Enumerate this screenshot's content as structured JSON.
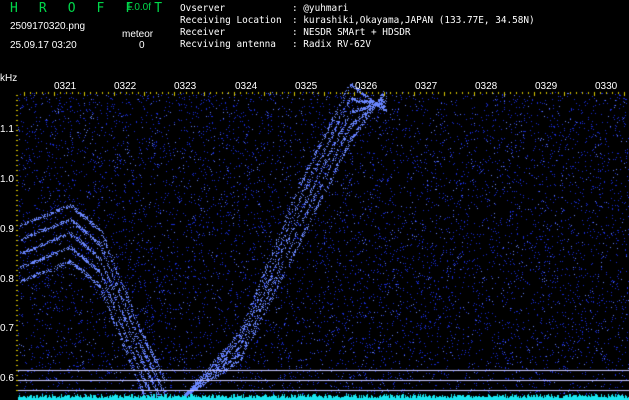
{
  "header": {
    "app_name": "H R O F F T",
    "version": "1.0.0f",
    "file_name": "2509170320.png",
    "timestamp": "25.09.17 03:20",
    "meteor_label": "meteor",
    "meteor_count": "0"
  },
  "station": [
    {
      "key": "Ovserver",
      "value": ": @yuhmari"
    },
    {
      "key": "Receiving Location",
      "value": ": kurashiki,Okayama,JAPAN (133.77E, 34.58N)"
    },
    {
      "key": "Receiver",
      "value": ": NESDR SMArt + HDSDR"
    },
    {
      "key": "Recviving antenna",
      "value": ": Radix RV-62V"
    }
  ],
  "time_axis": {
    "labels": [
      "0321",
      "0322",
      "0323",
      "0324",
      "0325",
      "0326",
      "0327",
      "0328",
      "0329",
      "0330"
    ]
  },
  "freq_axis": {
    "unit": "kHz",
    "labels": [
      "1.1",
      "1.0",
      "0.9",
      "0.8",
      "0.7",
      "0.6"
    ]
  },
  "colors": {
    "background": "#000000",
    "header_green": "#00d84a",
    "noise_blue": "#1a2cd8",
    "signal_blue": "#6a86ff",
    "tick_yellow": "#d9c800",
    "baseline_cyan": "#19e6f0",
    "grid_line": "#c8c8ff"
  }
}
